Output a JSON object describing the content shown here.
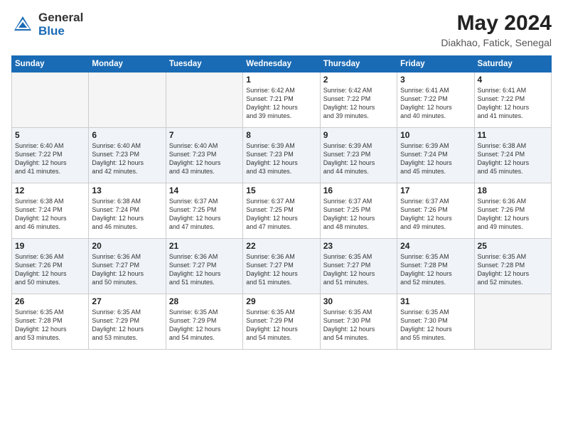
{
  "logo": {
    "general": "General",
    "blue": "Blue"
  },
  "title": {
    "month_year": "May 2024",
    "location": "Diakhao, Fatick, Senegal"
  },
  "days_of_week": [
    "Sunday",
    "Monday",
    "Tuesday",
    "Wednesday",
    "Thursday",
    "Friday",
    "Saturday"
  ],
  "weeks": [
    [
      {
        "day": "",
        "info": ""
      },
      {
        "day": "",
        "info": ""
      },
      {
        "day": "",
        "info": ""
      },
      {
        "day": "1",
        "info": "Sunrise: 6:42 AM\nSunset: 7:21 PM\nDaylight: 12 hours\nand 39 minutes."
      },
      {
        "day": "2",
        "info": "Sunrise: 6:42 AM\nSunset: 7:22 PM\nDaylight: 12 hours\nand 39 minutes."
      },
      {
        "day": "3",
        "info": "Sunrise: 6:41 AM\nSunset: 7:22 PM\nDaylight: 12 hours\nand 40 minutes."
      },
      {
        "day": "4",
        "info": "Sunrise: 6:41 AM\nSunset: 7:22 PM\nDaylight: 12 hours\nand 41 minutes."
      }
    ],
    [
      {
        "day": "5",
        "info": "Sunrise: 6:40 AM\nSunset: 7:22 PM\nDaylight: 12 hours\nand 41 minutes."
      },
      {
        "day": "6",
        "info": "Sunrise: 6:40 AM\nSunset: 7:23 PM\nDaylight: 12 hours\nand 42 minutes."
      },
      {
        "day": "7",
        "info": "Sunrise: 6:40 AM\nSunset: 7:23 PM\nDaylight: 12 hours\nand 43 minutes."
      },
      {
        "day": "8",
        "info": "Sunrise: 6:39 AM\nSunset: 7:23 PM\nDaylight: 12 hours\nand 43 minutes."
      },
      {
        "day": "9",
        "info": "Sunrise: 6:39 AM\nSunset: 7:23 PM\nDaylight: 12 hours\nand 44 minutes."
      },
      {
        "day": "10",
        "info": "Sunrise: 6:39 AM\nSunset: 7:24 PM\nDaylight: 12 hours\nand 45 minutes."
      },
      {
        "day": "11",
        "info": "Sunrise: 6:38 AM\nSunset: 7:24 PM\nDaylight: 12 hours\nand 45 minutes."
      }
    ],
    [
      {
        "day": "12",
        "info": "Sunrise: 6:38 AM\nSunset: 7:24 PM\nDaylight: 12 hours\nand 46 minutes."
      },
      {
        "day": "13",
        "info": "Sunrise: 6:38 AM\nSunset: 7:24 PM\nDaylight: 12 hours\nand 46 minutes."
      },
      {
        "day": "14",
        "info": "Sunrise: 6:37 AM\nSunset: 7:25 PM\nDaylight: 12 hours\nand 47 minutes."
      },
      {
        "day": "15",
        "info": "Sunrise: 6:37 AM\nSunset: 7:25 PM\nDaylight: 12 hours\nand 47 minutes."
      },
      {
        "day": "16",
        "info": "Sunrise: 6:37 AM\nSunset: 7:25 PM\nDaylight: 12 hours\nand 48 minutes."
      },
      {
        "day": "17",
        "info": "Sunrise: 6:37 AM\nSunset: 7:26 PM\nDaylight: 12 hours\nand 49 minutes."
      },
      {
        "day": "18",
        "info": "Sunrise: 6:36 AM\nSunset: 7:26 PM\nDaylight: 12 hours\nand 49 minutes."
      }
    ],
    [
      {
        "day": "19",
        "info": "Sunrise: 6:36 AM\nSunset: 7:26 PM\nDaylight: 12 hours\nand 50 minutes."
      },
      {
        "day": "20",
        "info": "Sunrise: 6:36 AM\nSunset: 7:27 PM\nDaylight: 12 hours\nand 50 minutes."
      },
      {
        "day": "21",
        "info": "Sunrise: 6:36 AM\nSunset: 7:27 PM\nDaylight: 12 hours\nand 51 minutes."
      },
      {
        "day": "22",
        "info": "Sunrise: 6:36 AM\nSunset: 7:27 PM\nDaylight: 12 hours\nand 51 minutes."
      },
      {
        "day": "23",
        "info": "Sunrise: 6:35 AM\nSunset: 7:27 PM\nDaylight: 12 hours\nand 51 minutes."
      },
      {
        "day": "24",
        "info": "Sunrise: 6:35 AM\nSunset: 7:28 PM\nDaylight: 12 hours\nand 52 minutes."
      },
      {
        "day": "25",
        "info": "Sunrise: 6:35 AM\nSunset: 7:28 PM\nDaylight: 12 hours\nand 52 minutes."
      }
    ],
    [
      {
        "day": "26",
        "info": "Sunrise: 6:35 AM\nSunset: 7:28 PM\nDaylight: 12 hours\nand 53 minutes."
      },
      {
        "day": "27",
        "info": "Sunrise: 6:35 AM\nSunset: 7:29 PM\nDaylight: 12 hours\nand 53 minutes."
      },
      {
        "day": "28",
        "info": "Sunrise: 6:35 AM\nSunset: 7:29 PM\nDaylight: 12 hours\nand 54 minutes."
      },
      {
        "day": "29",
        "info": "Sunrise: 6:35 AM\nSunset: 7:29 PM\nDaylight: 12 hours\nand 54 minutes."
      },
      {
        "day": "30",
        "info": "Sunrise: 6:35 AM\nSunset: 7:30 PM\nDaylight: 12 hours\nand 54 minutes."
      },
      {
        "day": "31",
        "info": "Sunrise: 6:35 AM\nSunset: 7:30 PM\nDaylight: 12 hours\nand 55 minutes."
      },
      {
        "day": "",
        "info": ""
      }
    ]
  ]
}
